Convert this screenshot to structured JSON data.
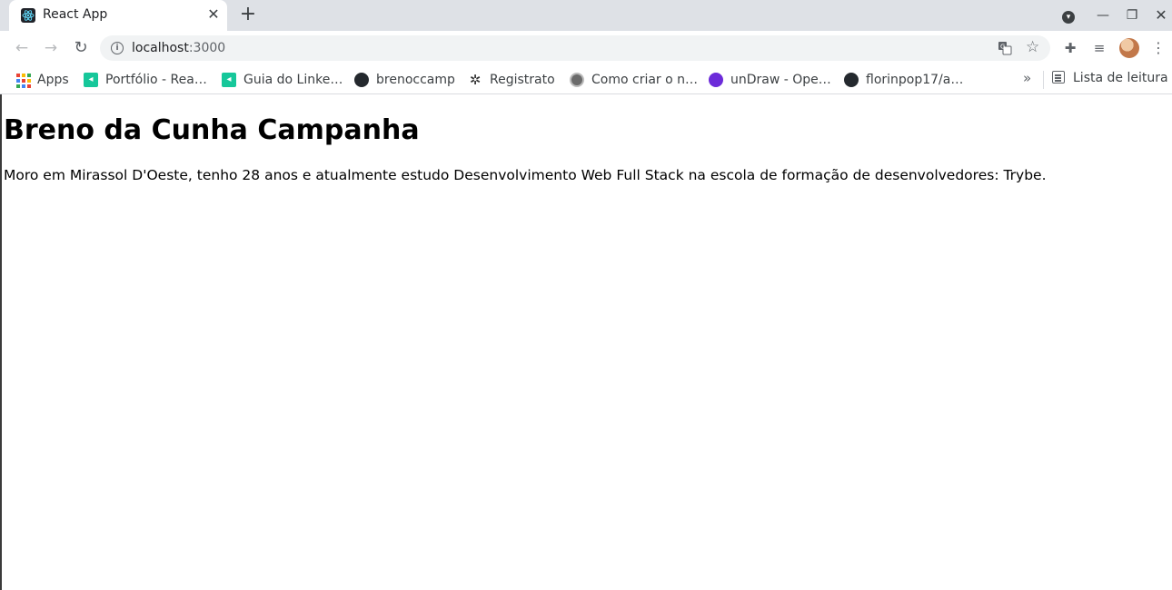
{
  "browser": {
    "tab": {
      "title": "React App"
    },
    "toolbar": {
      "url_host": "localhost",
      "url_port": ":3000"
    },
    "bookmarks": [
      {
        "label": "Apps",
        "icon": "apps-grid-icon"
      },
      {
        "label": "Portfólio - Rea…",
        "icon": "green-square-icon"
      },
      {
        "label": "Guia do Linke…",
        "icon": "green-square-icon"
      },
      {
        "label": "brenoccamp",
        "icon": "github-icon"
      },
      {
        "label": "Registrato",
        "icon": "gear-icon"
      },
      {
        "label": "Como criar o n…",
        "icon": "round-logo-icon"
      },
      {
        "label": "unDraw - Ope…",
        "icon": "undraw-icon"
      },
      {
        "label": "florinpop17/a…",
        "icon": "github-icon"
      }
    ],
    "reading_list": "Lista de leitura",
    "colors": {
      "tabstrip": "#dee1e6",
      "omnibox": "#f1f3f4"
    }
  },
  "page": {
    "heading": "Breno da Cunha Campanha",
    "bio": "Moro em Mirassol D'Oeste, tenho 28 anos e atualmente estudo Desenvolvimento Web Full Stack na escola de formação de desenvolvedores: Trybe."
  }
}
